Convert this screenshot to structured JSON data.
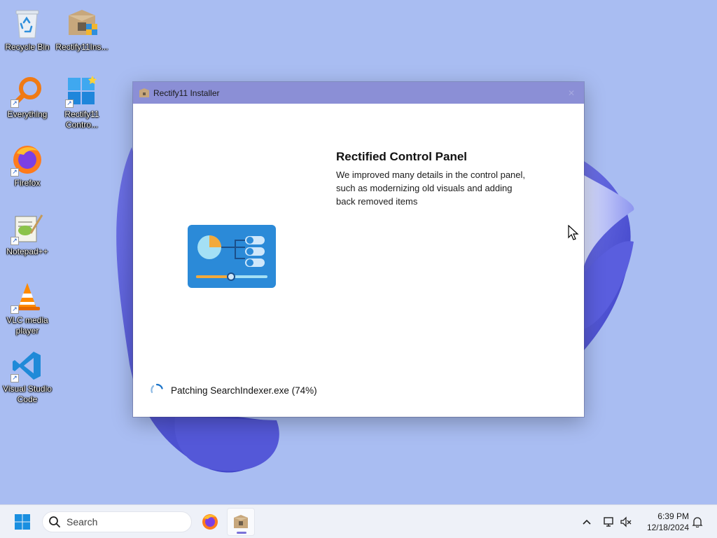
{
  "desktop": {
    "icons": [
      {
        "label": "Recycle Bin",
        "icon": "recycle-bin-icon"
      },
      {
        "label": "Rectify11Ins...",
        "icon": "installer-package-icon"
      },
      {
        "label": "Everything",
        "icon": "everything-search-icon"
      },
      {
        "label": "Rectify11\nContro...",
        "icon": "windows-control-icon"
      },
      {
        "label": "Firefox",
        "icon": "firefox-icon"
      },
      {
        "label": "Notepad++",
        "icon": "notepad-plus-plus-icon"
      },
      {
        "label": "VLC media\nplayer",
        "icon": "vlc-cone-icon"
      },
      {
        "label": "Visual Studio\nCode",
        "icon": "vscode-icon"
      }
    ]
  },
  "installer": {
    "title": "Rectify11 Installer",
    "close_glyph": "✕",
    "feature_heading": "Rectified Control Panel",
    "feature_description": "We improved many details in the control panel, such as modernizing old visuals and adding back removed items",
    "status_text": "Patching SearchIndexer.exe (74%)",
    "progress_percent": 74
  },
  "taskbar": {
    "search_placeholder": "Search",
    "pinned": [
      "start-icon",
      "search-icon",
      "firefox-icon",
      "installer-package-icon"
    ],
    "tray": [
      "chevron-up-icon",
      "network-icon",
      "volume-muted-icon",
      "notification-bell-icon"
    ],
    "time": "6:39 PM",
    "date": "12/18/2024"
  },
  "colors": {
    "desktop_bg": "#a9bdf2",
    "titlebar": "#8b8fd6",
    "bloom_dark": "#4a4fd0",
    "bloom_light": "#c9d3fb",
    "accent_blue": "#1a73c8",
    "graphic_bg": "#2b8ad8",
    "graphic_orange": "#f2a93b"
  }
}
